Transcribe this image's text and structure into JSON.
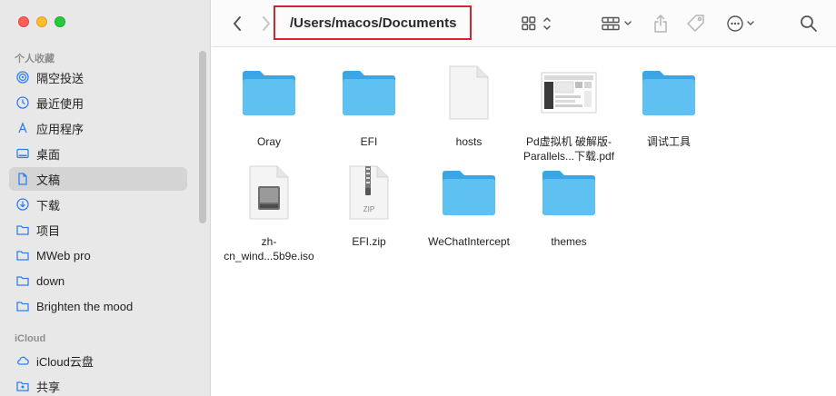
{
  "window": {
    "title": "Documents"
  },
  "sidebar": {
    "favorites_header": "个人收藏",
    "favorites": [
      {
        "label": "隔空投送",
        "icon": "airdrop-icon"
      },
      {
        "label": "最近使用",
        "icon": "clock-icon"
      },
      {
        "label": "应用程序",
        "icon": "applications-icon"
      },
      {
        "label": "桌面",
        "icon": "desktop-icon"
      },
      {
        "label": "文稿",
        "icon": "document-icon",
        "selected": true
      },
      {
        "label": "下载",
        "icon": "download-icon"
      },
      {
        "label": "项目",
        "icon": "folder-icon"
      },
      {
        "label": "MWeb pro",
        "icon": "folder-icon"
      },
      {
        "label": "down",
        "icon": "folder-icon"
      },
      {
        "label": "Brighten the mood",
        "icon": "folder-icon"
      }
    ],
    "icloud_header": "iCloud",
    "icloud": [
      {
        "label": "iCloud云盘",
        "icon": "cloud-icon"
      },
      {
        "label": "共享",
        "icon": "shared-folder-icon"
      }
    ]
  },
  "toolbar": {
    "path": "/Users/macos/Documents",
    "icons": [
      "back-icon",
      "forward-icon",
      "view-grid-icon",
      "group-icon",
      "share-icon",
      "tag-icon",
      "more-icon",
      "search-icon"
    ]
  },
  "files": [
    {
      "name": "Oray",
      "type": "folder"
    },
    {
      "name": "EFI",
      "type": "folder"
    },
    {
      "name": "hosts",
      "type": "document"
    },
    {
      "name": "Pd虚拟机 破解版-\nParallels...下载.pdf",
      "type": "pdf"
    },
    {
      "name": "调试工具",
      "type": "folder"
    },
    {
      "name": "zh-\ncn_wind...5b9e.iso",
      "type": "iso"
    },
    {
      "name": "EFI.zip",
      "type": "zip",
      "badge": "ZIP"
    },
    {
      "name": "WeChatIntercept",
      "type": "folder"
    },
    {
      "name": "themes",
      "type": "folder"
    }
  ],
  "colors": {
    "folder": "#5ec1f2",
    "folder_tab": "#3aa6e6",
    "selection": "#d5d4d5",
    "sidebar_accent": "#2f7ff0",
    "highlight_box": "#d0272e"
  }
}
